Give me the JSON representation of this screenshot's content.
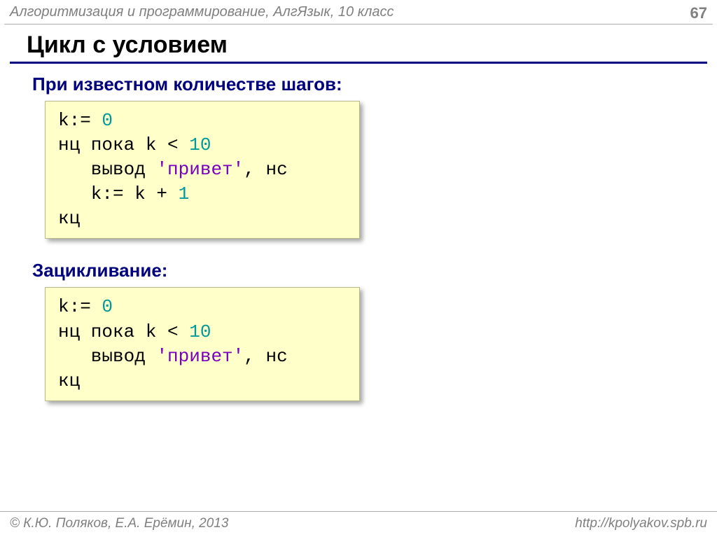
{
  "header": {
    "course": "Алгоритмизация и программирование, АлгЯзык, 10 класс",
    "page": "67"
  },
  "title": "Цикл с условием",
  "section1": {
    "label": "При известном количестве шагов:",
    "code": {
      "l1a": "k:= ",
      "l1b": "0",
      "l2a": "нц пока k < ",
      "l2b": "10",
      "l3a": "   вывод ",
      "l3b": "'привет'",
      "l3c": ", нс",
      "l4a": "   k:= k + ",
      "l4b": "1",
      "l5": "кц"
    }
  },
  "section2": {
    "label": "Зацикливание:",
    "code": {
      "l1a": "k:= ",
      "l1b": "0",
      "l2a": "нц пока k < ",
      "l2b": "10",
      "l3a": "   вывод ",
      "l3b": "'привет'",
      "l3c": ", нс",
      "l4": "кц"
    }
  },
  "footer": {
    "left": "© К.Ю. Поляков, Е.А. Ерёмин, 2013",
    "right": "http://kpolyakov.spb.ru"
  }
}
